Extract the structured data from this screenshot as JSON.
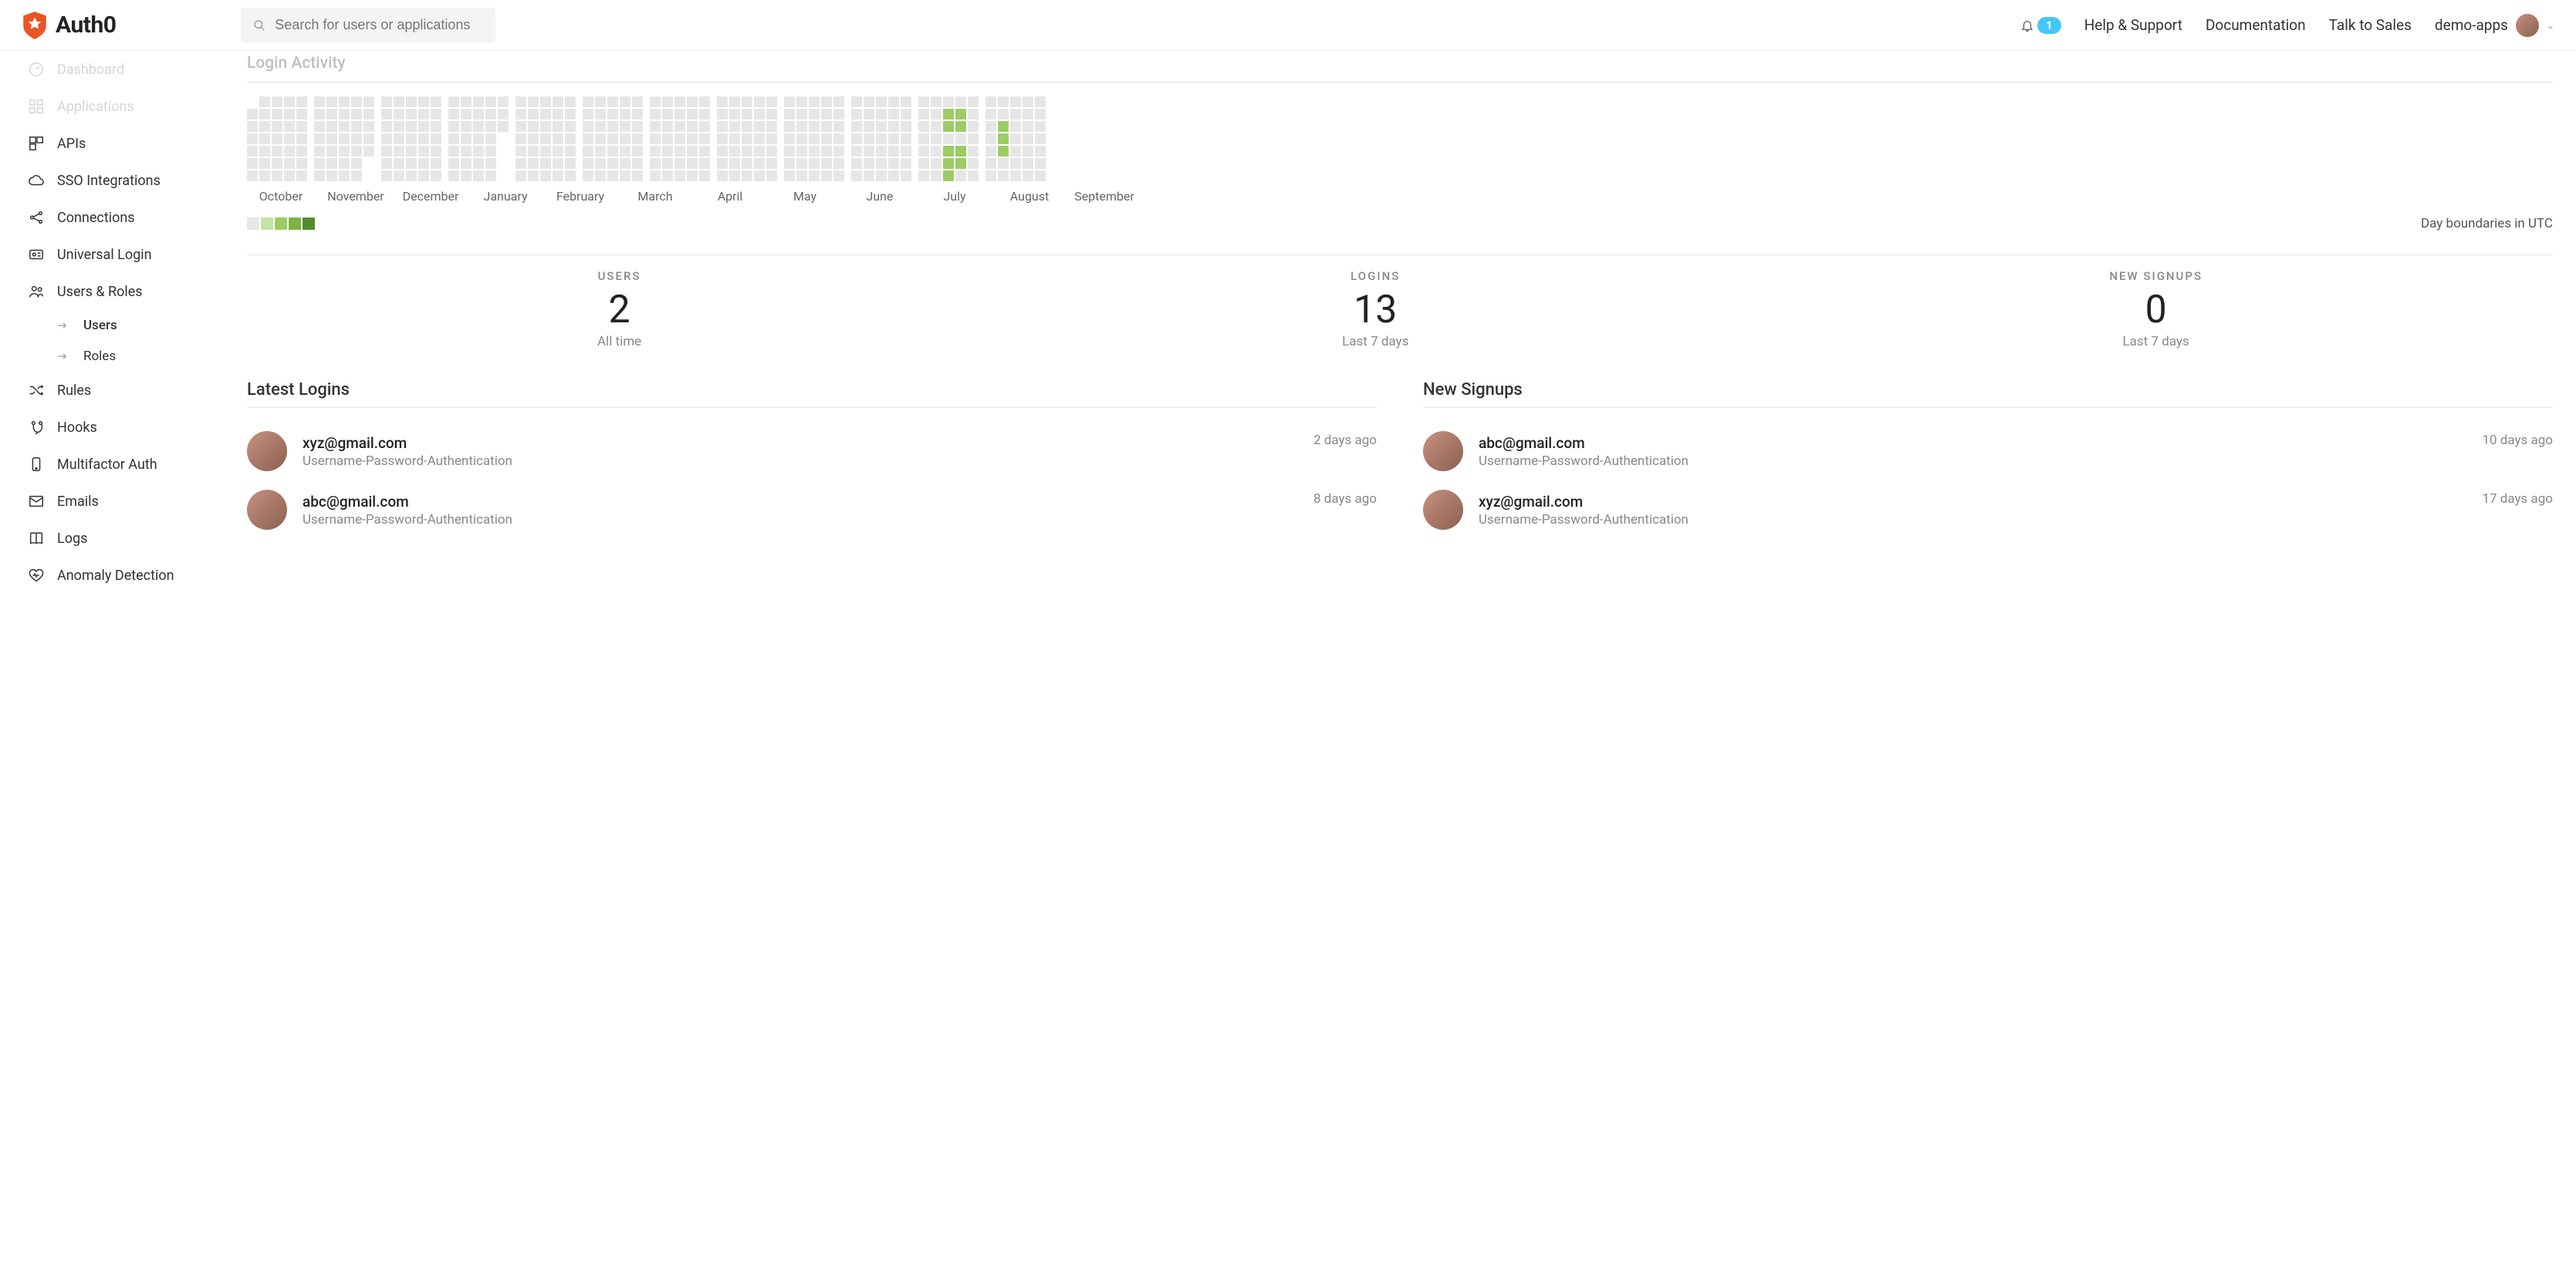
{
  "header": {
    "brand": "Auth0",
    "search_placeholder": "Search for users or applications",
    "notifications_count": "1",
    "links": {
      "help": "Help & Support",
      "docs": "Documentation",
      "sales": "Talk to Sales"
    },
    "tenant": "demo-apps"
  },
  "sidebar": {
    "items": [
      {
        "label": "Dashboard",
        "icon": "gauge-icon",
        "faded": true
      },
      {
        "label": "Applications",
        "icon": "apps-icon",
        "faded": true
      },
      {
        "label": "APIs",
        "icon": "blocks-icon"
      },
      {
        "label": "SSO Integrations",
        "icon": "cloud-icon"
      },
      {
        "label": "Connections",
        "icon": "share-icon"
      },
      {
        "label": "Universal Login",
        "icon": "id-card-icon"
      },
      {
        "label": "Users & Roles",
        "icon": "people-icon"
      },
      {
        "label": "Rules",
        "icon": "shuffle-icon"
      },
      {
        "label": "Hooks",
        "icon": "hook-icon"
      },
      {
        "label": "Multifactor Auth",
        "icon": "phone-icon"
      },
      {
        "label": "Emails",
        "icon": "mail-icon"
      },
      {
        "label": "Logs",
        "icon": "book-icon"
      },
      {
        "label": "Anomaly Detection",
        "icon": "heart-icon"
      }
    ],
    "users_roles_sub": [
      {
        "label": "Users",
        "active": true
      },
      {
        "label": "Roles"
      }
    ]
  },
  "activity": {
    "title": "Login Activity",
    "months": [
      "October",
      "November",
      "December",
      "January",
      "February",
      "March",
      "April",
      "May",
      "June",
      "July",
      "August",
      "September"
    ],
    "utc_note": "Day boundaries in UTC"
  },
  "stats": {
    "users": {
      "label": "USERS",
      "value": "2",
      "sub": "All time"
    },
    "logins": {
      "label": "LOGINS",
      "value": "13",
      "sub": "Last 7 days"
    },
    "signups": {
      "label": "NEW SIGNUPS",
      "value": "0",
      "sub": "Last 7 days"
    }
  },
  "latest_logins": {
    "title": "Latest Logins",
    "rows": [
      {
        "email": "xyz@gmail.com",
        "connection": "Username-Password-Authentication",
        "time": "2 days ago"
      },
      {
        "email": "abc@gmail.com",
        "connection": "Username-Password-Authentication",
        "time": "8 days ago"
      }
    ]
  },
  "new_signups": {
    "title": "New Signups",
    "rows": [
      {
        "email": "abc@gmail.com",
        "connection": "Username-Password-Authentication",
        "time": "10 days ago"
      },
      {
        "email": "xyz@gmail.com",
        "connection": "Username-Password-Authentication",
        "time": "17 days ago"
      }
    ]
  },
  "chart_data": {
    "type": "heatmap",
    "title": "Login Activity",
    "months": [
      "October",
      "November",
      "December",
      "January",
      "February",
      "March",
      "April",
      "May",
      "June",
      "July",
      "August",
      "September"
    ],
    "note": "Day boundaries in UTC",
    "intensity_scale": [
      0,
      1,
      2,
      3,
      4
    ],
    "active_cells": {
      "August": [
        {
          "week": 2,
          "day": 1,
          "intensity": 2
        },
        {
          "week": 2,
          "day": 2,
          "intensity": 2
        },
        {
          "week": 3,
          "day": 1,
          "intensity": 2
        },
        {
          "week": 3,
          "day": 2,
          "intensity": 2
        },
        {
          "week": 2,
          "day": 4,
          "intensity": 2
        },
        {
          "week": 3,
          "day": 4,
          "intensity": 2
        },
        {
          "week": 2,
          "day": 5,
          "intensity": 2
        },
        {
          "week": 3,
          "day": 5,
          "intensity": 2
        },
        {
          "week": 2,
          "day": 6,
          "intensity": 2
        }
      ],
      "September": [
        {
          "week": 1,
          "day": 2,
          "intensity": 2
        },
        {
          "week": 1,
          "day": 3,
          "intensity": 2
        },
        {
          "week": 1,
          "day": 4,
          "intensity": 2
        }
      ]
    }
  }
}
